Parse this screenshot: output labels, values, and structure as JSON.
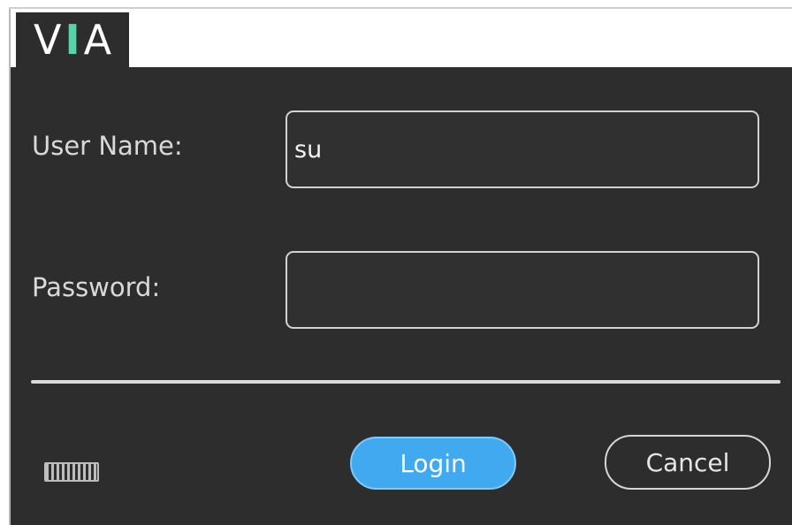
{
  "logo": {
    "letter_v": "V",
    "letter_i": "I",
    "letter_a": "A"
  },
  "form": {
    "username_label": "User Name:",
    "username_value": "su",
    "password_label": "Password:",
    "password_value": ""
  },
  "buttons": {
    "login_label": "Login",
    "cancel_label": "Cancel"
  },
  "icons": {
    "keyboard": "keyboard-icon"
  },
  "colors": {
    "panel_bg": "#2d2d2d",
    "accent_login": "#40a9f0",
    "logo_accent": "#59d3a8"
  }
}
